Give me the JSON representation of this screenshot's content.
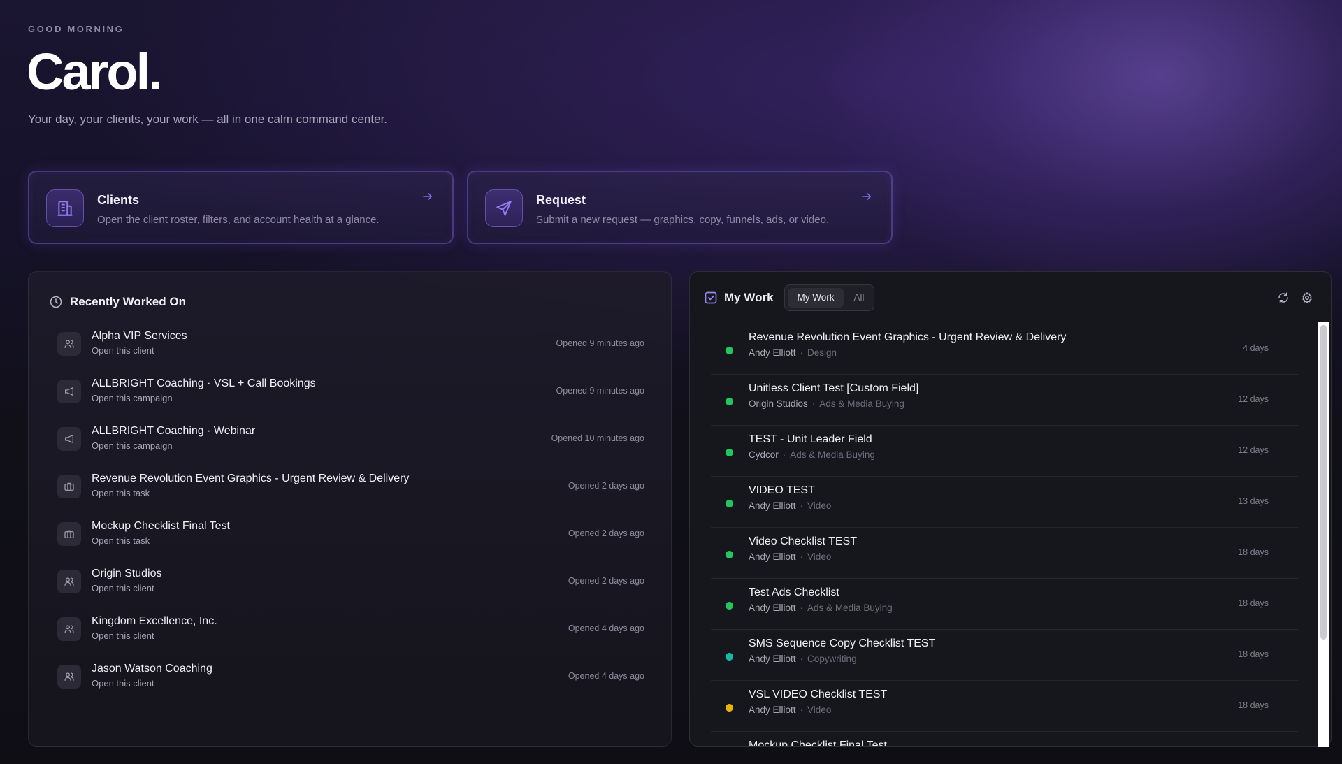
{
  "header": {
    "greeting": "GOOD MORNING",
    "name": "Carol.",
    "subtitle": "Your day, your clients, your work — all in one calm command center."
  },
  "cards": {
    "clients": {
      "title": "Clients",
      "description": "Open the client roster, filters, and account health at a glance.",
      "icon": "building-icon"
    },
    "request": {
      "title": "Request",
      "description": "Submit a new request — graphics, copy, funnels, ads, or video.",
      "icon": "send-icon"
    }
  },
  "recent": {
    "title": "Recently Worked On",
    "items": [
      {
        "title": "Alpha VIP Services",
        "subtitle": "Open this client",
        "time": "Opened 9 minutes ago",
        "icon": "users-icon"
      },
      {
        "title": "ALLBRIGHT Coaching · VSL + Call Bookings",
        "subtitle": "Open this campaign",
        "time": "Opened 9 minutes ago",
        "icon": "megaphone-icon"
      },
      {
        "title": "ALLBRIGHT Coaching · Webinar",
        "subtitle": "Open this campaign",
        "time": "Opened 10 minutes ago",
        "icon": "megaphone-icon"
      },
      {
        "title": "Revenue Revolution Event Graphics - Urgent Review & Delivery",
        "subtitle": "Open this task",
        "time": "Opened 2 days ago",
        "icon": "briefcase-icon"
      },
      {
        "title": "Mockup Checklist Final Test",
        "subtitle": "Open this task",
        "time": "Opened 2 days ago",
        "icon": "briefcase-icon"
      },
      {
        "title": "Origin Studios",
        "subtitle": "Open this client",
        "time": "Opened 2 days ago",
        "icon": "users-icon"
      },
      {
        "title": "Kingdom Excellence, Inc.",
        "subtitle": "Open this client",
        "time": "Opened 4 days ago",
        "icon": "users-icon"
      },
      {
        "title": "Jason Watson Coaching",
        "subtitle": "Open this client",
        "time": "Opened 4 days ago",
        "icon": "users-icon"
      }
    ]
  },
  "mywork": {
    "title": "My Work",
    "segments": {
      "active": "My Work",
      "other": "All"
    },
    "items": [
      {
        "title": "Revenue Revolution Event Graphics - Urgent Review & Delivery",
        "owner": "Andy Elliott",
        "category": "Design",
        "days": "4 days",
        "status_color": "#22c55e"
      },
      {
        "title": "Unitless Client Test [Custom Field]",
        "owner": "Origin Studios",
        "category": "Ads & Media Buying",
        "days": "12 days",
        "status_color": "#22c55e"
      },
      {
        "title": "TEST - Unit Leader Field",
        "owner": "Cydcor",
        "category": "Ads & Media Buying",
        "days": "12 days",
        "status_color": "#22c55e"
      },
      {
        "title": "VIDEO TEST",
        "owner": "Andy Elliott",
        "category": "Video",
        "days": "13 days",
        "status_color": "#22c55e"
      },
      {
        "title": "Video Checklist TEST",
        "owner": "Andy Elliott",
        "category": "Video",
        "days": "18 days",
        "status_color": "#22c55e"
      },
      {
        "title": "Test Ads Checklist",
        "owner": "Andy Elliott",
        "category": "Ads & Media Buying",
        "days": "18 days",
        "status_color": "#22c55e"
      },
      {
        "title": "SMS Sequence Copy Checklist TEST",
        "owner": "Andy Elliott",
        "category": "Copywriting",
        "days": "18 days",
        "status_color": "#14b8a6"
      },
      {
        "title": "VSL VIDEO Checklist TEST",
        "owner": "Andy Elliott",
        "category": "Video",
        "days": "18 days",
        "status_color": "#eab308"
      },
      {
        "title": "Mockup Checklist Final Test",
        "owner": "",
        "category": "",
        "days": "",
        "status_color": "#22c55e"
      }
    ]
  },
  "colors": {
    "accent": "#7a62d6",
    "panel": "#16171c"
  }
}
